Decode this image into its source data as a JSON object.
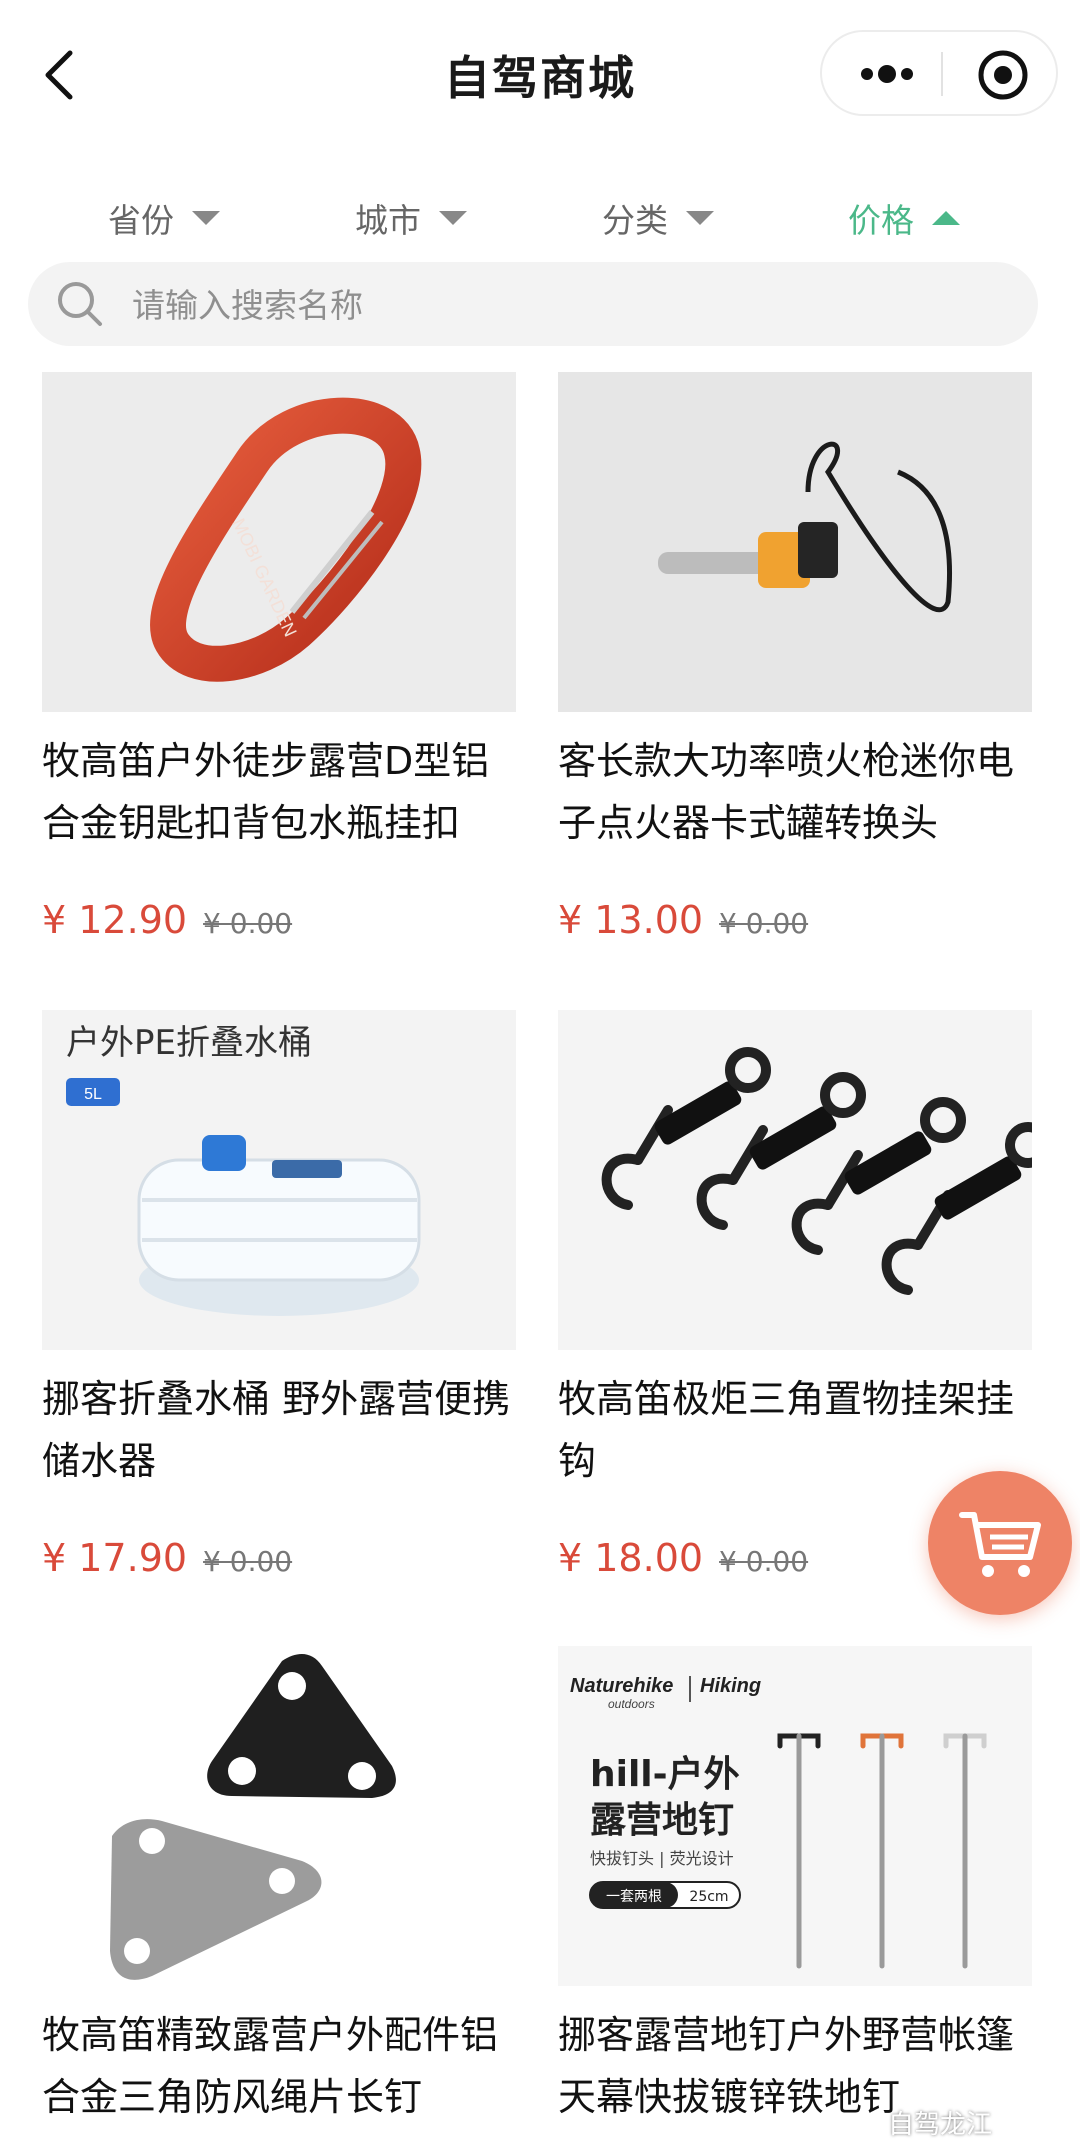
{
  "header": {
    "title": "自驾商城"
  },
  "filters": [
    {
      "label": "省份"
    },
    {
      "label": "城市"
    },
    {
      "label": "分类"
    },
    {
      "label": "价格"
    }
  ],
  "active_filter_color": "#4bb889",
  "price_color": "#d94a3a",
  "search": {
    "placeholder": "请输入搜索名称"
  },
  "products": [
    {
      "name": "牧高笛户外徒步露营D型铝合金钥匙扣背包水瓶挂扣",
      "price": "¥ 12.90",
      "original_price": "¥ 0.00",
      "image_icon": "carabiner-image",
      "image_text": "MOBI GARDEN"
    },
    {
      "name": "客长款大功率喷火枪迷你电子点火器卡式罐转换头",
      "price": "¥ 13.00",
      "original_price": "¥ 0.00",
      "image_icon": "fire-starter-image"
    },
    {
      "name": "挪客折叠水桶 野外露营便携储水器",
      "price": "¥ 17.90",
      "original_price": "¥ 0.00",
      "image_icon": "water-bucket-image",
      "image_title": "户外PE折叠水桶",
      "image_badge": "5L"
    },
    {
      "name": "牧高笛极炬三角置物挂架挂钩",
      "price": "¥ 18.00",
      "original_price": "¥ 0.00",
      "image_icon": "hooks-image"
    },
    {
      "name": "牧高笛精致露营户外配件铝合金三角防风绳片长钉",
      "price": "",
      "original_price": "",
      "image_icon": "triangle-plate-image"
    },
    {
      "name": "挪客露营地钉户外野营帐篷天幕快拔镀锌铁地钉",
      "price": "",
      "original_price": "",
      "image_icon": "tent-stake-image",
      "image_brand": "Naturehike",
      "image_brand_sub": "outdoors",
      "image_tag": "Hiking",
      "image_title1": "hill-户外",
      "image_title2": "露营地钉",
      "image_sub": "快拔钉头 | 荧光设计",
      "image_pill1": "一套两根",
      "image_pill2": "25cm"
    }
  ],
  "watermark": "自驾龙江"
}
